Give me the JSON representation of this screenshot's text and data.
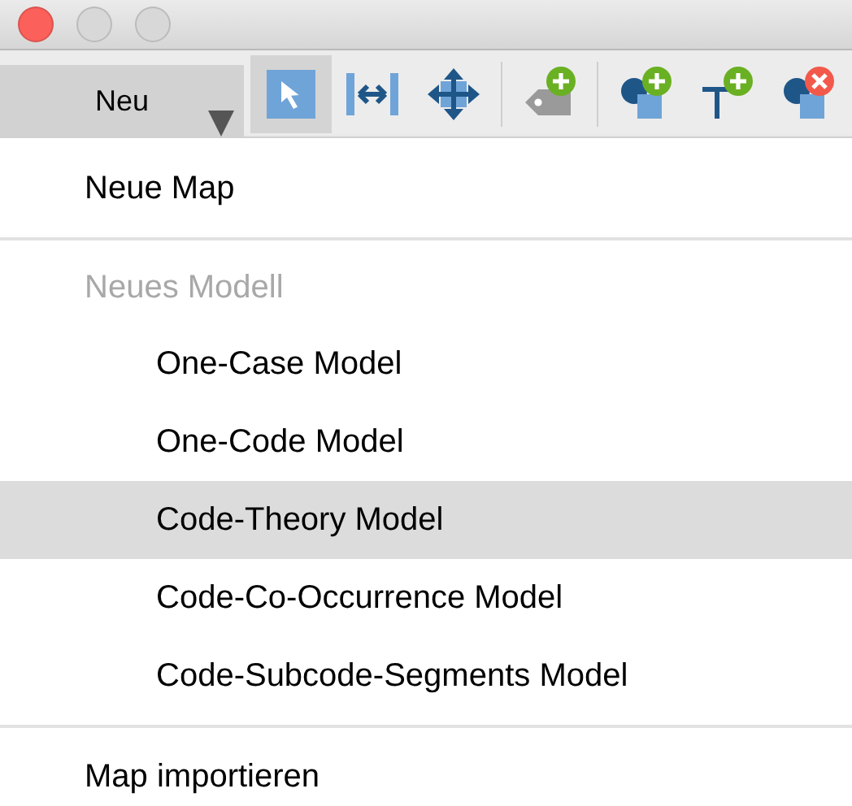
{
  "window": {
    "buttons": [
      {
        "color": "#fc605b"
      },
      {
        "color": "#d8d8d8"
      },
      {
        "color": "#d8d8d8"
      }
    ]
  },
  "toolbar": {
    "new_button": {
      "label": "Neu",
      "expanded": true
    },
    "tools": [
      {
        "kind": "pointer",
        "selected": true
      },
      {
        "kind": "width",
        "selected": false
      },
      {
        "kind": "move",
        "selected": false
      },
      {
        "kind": "separator"
      },
      {
        "kind": "tag-add",
        "selected": false
      },
      {
        "kind": "separator"
      },
      {
        "kind": "shape-add",
        "selected": false
      },
      {
        "kind": "text-add",
        "selected": false
      },
      {
        "kind": "shape-remove",
        "selected": false
      }
    ]
  },
  "menu": {
    "items": [
      {
        "kind": "item",
        "label": "Neue Map",
        "selected": false
      },
      {
        "kind": "separator"
      },
      {
        "kind": "header",
        "label": "Neues Modell",
        "disabled": true,
        "children": [
          {
            "label": "One-Case Model",
            "selected": false
          },
          {
            "label": "One-Code Model",
            "selected": false
          },
          {
            "label": "Code-Theory Model",
            "selected": true
          },
          {
            "label": "Code-Co-Occurrence Model",
            "selected": false
          },
          {
            "label": "Code-Subcode-Segments Model",
            "selected": false
          }
        ]
      },
      {
        "kind": "separator"
      },
      {
        "kind": "item",
        "label": "Map importieren",
        "selected": false
      }
    ]
  }
}
